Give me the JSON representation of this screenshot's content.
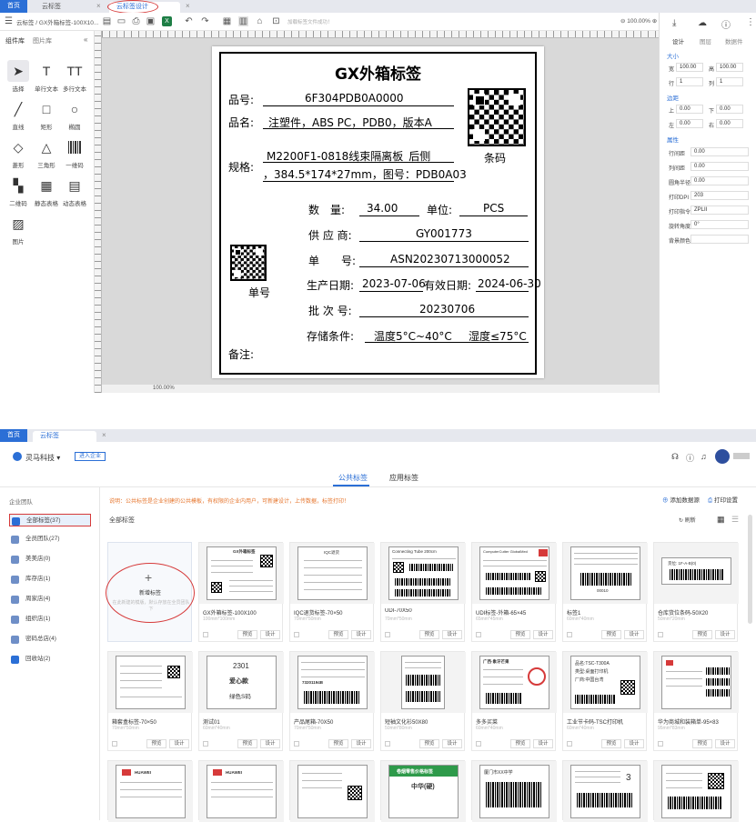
{
  "designer": {
    "tabs": [
      "首页",
      "云标签",
      "云标签设计"
    ],
    "breadcrumb": "云标签 / GX外箱标签-100X10...",
    "hint": "加载标签文件成功！",
    "zoom": "100.00%",
    "left_tabs": [
      "组件库",
      "图片库"
    ],
    "tools": [
      {
        "label": "选择",
        "icon": "cursor-icon"
      },
      {
        "label": "单行文本",
        "icon": "text-icon"
      },
      {
        "label": "多行文本",
        "icon": "multiline-text-icon"
      },
      {
        "label": "直线",
        "icon": "line-icon"
      },
      {
        "label": "矩形",
        "icon": "rectangle-icon"
      },
      {
        "label": "椭圆",
        "icon": "ellipse-icon"
      },
      {
        "label": "菱形",
        "icon": "diamond-icon"
      },
      {
        "label": "三角形",
        "icon": "triangle-icon"
      },
      {
        "label": "一维码",
        "icon": "barcode-icon"
      },
      {
        "label": "二维码",
        "icon": "qrcode-icon"
      },
      {
        "label": "静态表格",
        "icon": "table-icon"
      },
      {
        "label": "动态表格",
        "icon": "dynamic-table-icon"
      },
      {
        "label": "图片",
        "icon": "image-icon"
      }
    ],
    "canvas_zoom": "100.00%",
    "label": {
      "title": "GX外箱标签",
      "part_no_label": "品号:",
      "part_no": "6F304PDB0A0000",
      "name_label": "品名:",
      "name": "注塑件，ABS PC，PDB0，版本A",
      "spec_label": "规格:",
      "spec_line1": "M2200F1-0818线束隔离板_后侧",
      "spec_line2": "，384.5*174*27mm，图号：PDB0A03",
      "barcode_caption": "条码",
      "qty_label": "数　量:",
      "qty": "34.00",
      "unit_label": "单位:",
      "unit": "PCS",
      "supplier_label": "供 应 商:",
      "supplier": "GY001773",
      "order_label": "单　　号:",
      "order": "ASN20230713000052",
      "prod_date_label": "生产日期:",
      "prod_date": "2023-07-06",
      "exp_date_label": "有效日期:",
      "exp_date": "2024-06-30",
      "batch_label": "批 次 号:",
      "batch": "20230706",
      "storage_label": "存储条件:",
      "temp": "温度5°C~40°C",
      "humidity": "湿度≤75°C",
      "order_caption": "单号",
      "remark_label": "备注:"
    },
    "right": {
      "icons": [
        "download-icon",
        "upload-icon",
        "help-icon"
      ],
      "tabs": [
        "设计",
        "图层",
        "数据件"
      ],
      "size_title": "大小",
      "width_label": "宽",
      "width": "100.00",
      "height_label": "高",
      "height": "100.00",
      "row_label": "行",
      "row": "1",
      "col_label": "列",
      "col": "1",
      "margin_title": "边距",
      "top_label": "上",
      "top": "0.00",
      "bottom_label": "下",
      "bottom": "0.00",
      "left_label": "左",
      "left": "0.00",
      "right_label": "右",
      "right": "0.00",
      "attr_title": "属性",
      "row_gap_label": "行间距",
      "row_gap": "0.00",
      "col_gap_label": "列间距",
      "col_gap": "0.00",
      "radius_label": "圆角半径",
      "radius": "0.00",
      "dpi_label": "打印DPI",
      "dpi": "203",
      "cmd_label": "打印指令",
      "cmd": "ZPLII",
      "rotate_label": "旋转角度",
      "rotate": "0°",
      "bg_label": "背景颜色"
    }
  },
  "library": {
    "tabs": [
      "首页",
      "云标签"
    ],
    "company": "灵马科技",
    "enter_company": "进入企业",
    "segments": [
      "公共标签",
      "应用标签"
    ],
    "notice": "说明：公共标签是企业创建的公共模板，有权限的企业内用户，可新建设计，上传数据，标签打印！",
    "add_source": "添加数据源",
    "print_settings": "打印设置",
    "section_title": "全部标签",
    "refresh": "刷新",
    "team_title": "企业团队",
    "teams": [
      "全部标签(37)",
      "全员团队(27)",
      "美美店(0)",
      "库存店(1)",
      "周家店(4)",
      "组织店(1)",
      "密码总店(4)",
      "回收站(2)"
    ],
    "new_label": "新增标签",
    "new_hint": "在此新建的模版，默认存放在全员团队下",
    "preview": "预览",
    "design": "设计",
    "cards": [
      {
        "name": "GX外箱标签-100X100",
        "size": "100mm*100mm"
      },
      {
        "name": "IQC退货标签-70×50",
        "size": "70mm*50mm"
      },
      {
        "name": "UDI-70X50",
        "size": "70mm*50mm"
      },
      {
        "name": "UDI标签-外箱-65×45",
        "size": "65mm*45mm"
      },
      {
        "name": "标签1",
        "size": "60mm*40mm"
      },
      {
        "name": "仓库货位条码-50X20",
        "size": "50mm*20mm"
      },
      {
        "name": "箱套盒标签-70×50",
        "size": "70mm*50mm"
      },
      {
        "name": "测试01",
        "size": "60mm*40mm"
      },
      {
        "name": "产品尾箱-70X50",
        "size": "70mm*50mm"
      },
      {
        "name": "短袖文化衫50X80",
        "size": "50mm*80mm"
      },
      {
        "name": "多多买菜",
        "size": "60mm*40mm"
      },
      {
        "name": "工业节卡码-TSC打印机",
        "size": "60mm*40mm"
      },
      {
        "name": "华为商城和装箱单-95×83",
        "size": "95mm*83mm"
      }
    ],
    "thumb_texts": {
      "gx": "GX外箱标签",
      "iqc": "IQC退货",
      "udi": "Connecting Tube 200cm",
      "cutter": "ComputerCutter GlobalMed",
      "code": "00010",
      "shelf": "货位: 1F-A-B(0)",
      "test_num": "2301",
      "test_name": "爱心款",
      "test_size": "绿色S码",
      "tail_no": "73201194B",
      "food": "广西·象牙芒果",
      "tsc": "品名:TSC-T300A",
      "tsc_type": "类型:桌面打印机",
      "tsc_place": "厂商:中国台湾",
      "cig": "卷烟零售价格标签",
      "cig_mid": "中华(硬)",
      "school": "厦门市XX中学",
      "brand": "HUAWEI",
      "big3": "3"
    }
  }
}
